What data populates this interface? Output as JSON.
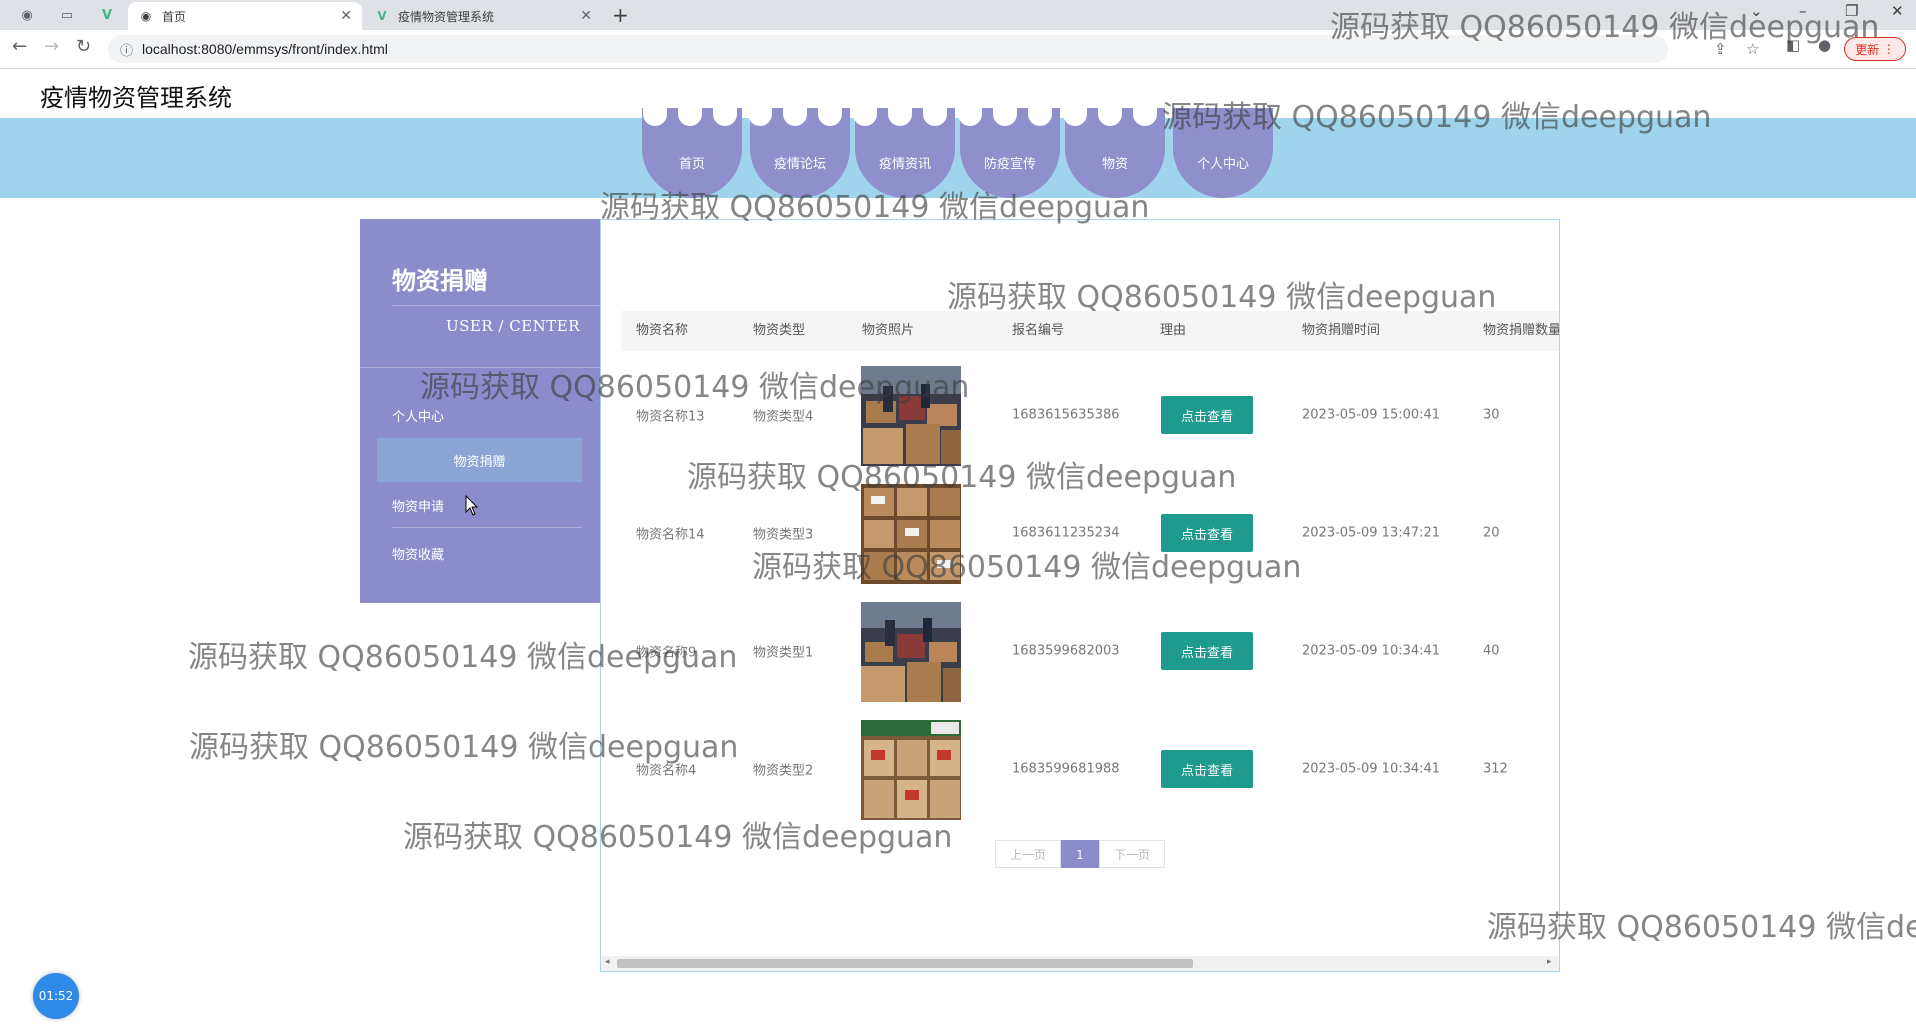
{
  "browser": {
    "tabs": [
      {
        "title": "首页",
        "active": true,
        "icon": "globe-icon"
      },
      {
        "title": "疫情物资管理系统",
        "active": false,
        "icon": "vue-icon"
      }
    ],
    "url": "localhost:8080/emmsys/front/index.html",
    "update_label": "更新"
  },
  "site": {
    "title": "疫情物资管理系统",
    "nav": [
      "首页",
      "疫情论坛",
      "疫情资讯",
      "防疫宣传",
      "物资",
      "个人中心"
    ]
  },
  "sidebar": {
    "title": "物资捐赠",
    "subtitle": "USER / CENTER",
    "items": [
      {
        "label": "个人中心",
        "active": false
      },
      {
        "label": "物资捐赠",
        "active": true
      },
      {
        "label": "物资申请",
        "active": false
      },
      {
        "label": "物资收藏",
        "active": false
      }
    ]
  },
  "table": {
    "columns": [
      "物资名称",
      "物资类型",
      "物资照片",
      "报名编号",
      "理由",
      "物资捐赠时间",
      "物资捐赠数量"
    ],
    "rows": [
      {
        "name": "物资名称13",
        "type": "物资类型4",
        "number": "1683615635386",
        "reason_button": "点击查看",
        "time": "2023-05-09 15:00:41",
        "quantity": "30"
      },
      {
        "name": "物资名称14",
        "type": "物资类型3",
        "number": "1683611235234",
        "reason_button": "点击查看",
        "time": "2023-05-09 13:47:21",
        "quantity": "20"
      },
      {
        "name": "物资名称9",
        "type": "物资类型1",
        "number": "1683599682003",
        "reason_button": "点击查看",
        "time": "2023-05-09 10:34:41",
        "quantity": "40"
      },
      {
        "name": "物资名称4",
        "type": "物资类型2",
        "number": "1683599681988",
        "reason_button": "点击查看",
        "time": "2023-05-09 10:34:41",
        "quantity": "312"
      }
    ]
  },
  "pagination": {
    "prev": "上一页",
    "current": "1",
    "next": "下一页"
  },
  "timer": "01:52",
  "watermark": "源码获取 QQ86050149 微信deepguan",
  "colors": {
    "nav_band": "#9fd4ec",
    "purple": "#8c8ccc",
    "button": "#1f9a8f"
  }
}
